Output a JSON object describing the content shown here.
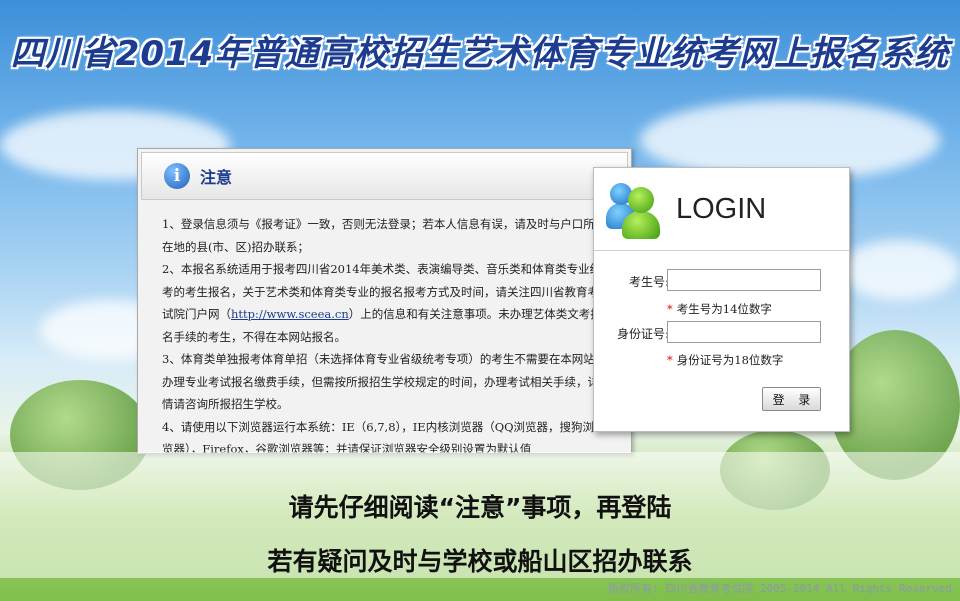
{
  "header": {
    "title": "四川省2014年普通高校招生艺术体育专业统考网上报名系统"
  },
  "notice": {
    "title": "注意",
    "items": {
      "p1": "1、登录信息须与《报考证》一致，否则无法登录；若本人信息有误，请及时与户口所在地的县(市、区)招办联系；",
      "p2_before": "2、本报名系统适用于报考四川省2014年美术类、表演编导类、音乐类和体育类专业统考的考生报名，关于艺术类和体育类专业的报名报考方式及时间，请关注四川省教育考试院门户网（",
      "p2_link": "http://www.sceea.cn",
      "p2_after": "）上的信息和有关注意事项。未办理艺体类文考报名手续的考生，不得在本网站报名。",
      "p3": "3、体育类单独报考体育单招（未选择体育专业省级统考专项）的考生不需要在本网站办理专业考试报名缴费手续，但需按所报招生学校规定的时间，办理考试相关手续，详情请咨询所报招生学校。",
      "p4": "4、请使用以下浏览器运行本系统：IE（6,7,8），IE内核浏览器（QQ浏览器，搜狗浏览器），Firefox，谷歌浏览器等；并请保证浏览器安全级别设置为默认值"
    }
  },
  "login": {
    "title": "LOGIN",
    "exam_no_label": "考生号:",
    "exam_no_value": "",
    "exam_no_hint": "考生号为14位数字",
    "id_label": "身份证号:",
    "id_value": "",
    "id_hint": "身份证号为18位数字",
    "submit_label": "登 录"
  },
  "banner": {
    "line1": "请先仔细阅读“注意”事项，再登陆",
    "line2": "若有疑问及时与学校或船山区招办联系"
  },
  "footer": {
    "copyright": "版权所有: 四川省教育考试院 2005-2014 All Rights Reserved"
  }
}
